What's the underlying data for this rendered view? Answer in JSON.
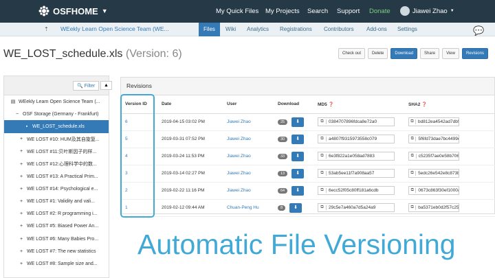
{
  "topnav": {
    "brand": "OSFHOME",
    "items": [
      "My Quick Files",
      "My Projects",
      "Search",
      "Support"
    ],
    "donate": "Donate",
    "user": "Jiawei Zhao"
  },
  "subnav": {
    "project": "WEekly Learn Open Science Team (WE...",
    "active": "Files",
    "items": [
      "Wiki",
      "Analytics",
      "Registrations",
      "Contributors",
      "Add-ons",
      "Settings"
    ]
  },
  "file": {
    "name": "WE_LOST_schedule.xls",
    "version": "(Version: 6)"
  },
  "buttons": [
    "Check out",
    "Delete",
    "Download",
    "Share",
    "View",
    "Revisions"
  ],
  "tree": {
    "filter": "Filter",
    "rows": [
      {
        "label": "WEekly Learn Open Science Team (...",
        "icon": "▤",
        "indent": 8
      },
      {
        "label": "OSF Storage (Germany - Frankfurt)",
        "icon": "−",
        "indent": 14
      },
      {
        "label": "WE_LOST_schedule.xls",
        "icon": "▪",
        "indent": 28,
        "selected": true
      },
      {
        "label": "WE LOST #10: HUM及其自旋复...",
        "icon": "+",
        "indent": 20
      },
      {
        "label": "WE LOST #11:贝叶斯因子的样...",
        "icon": "+",
        "indent": 20
      },
      {
        "label": "WE LOST #12:心理科学中的数...",
        "icon": "+",
        "indent": 20
      },
      {
        "label": "WE LOST #13: A Practical Prim...",
        "icon": "+",
        "indent": 20
      },
      {
        "label": "WE LOST #14: Psychological e...",
        "icon": "+",
        "indent": 20
      },
      {
        "label": "WE LOST #1: Validity and vali...",
        "icon": "+",
        "indent": 20
      },
      {
        "label": "WE LOST #2: R programming i...",
        "icon": "+",
        "indent": 20
      },
      {
        "label": "WE LOST #5: Biased Power An...",
        "icon": "+",
        "indent": 20
      },
      {
        "label": "WE LOST #6: Many Babies Pro...",
        "icon": "+",
        "indent": 20
      },
      {
        "label": "WE LOST #7: The new statistics",
        "icon": "+",
        "indent": 20
      },
      {
        "label": "WE LOST #8: Sample size and...",
        "icon": "+",
        "indent": 20
      }
    ]
  },
  "revisions": {
    "title": "Revisions",
    "headers": [
      "Version ID",
      "Date",
      "User",
      "Download",
      "MD5",
      "SHA2"
    ],
    "rows": [
      {
        "id": "6",
        "date": "2019-04-15 03:02 PM",
        "user": "Jiawei Zhao",
        "downloads": "25",
        "md5": "0384707896fdca8e72a0",
        "sha2": "bd812ea4542ad7db5058"
      },
      {
        "id": "5",
        "date": "2019-03-31 07:52 PM",
        "user": "Jiawei Zhao",
        "downloads": "30",
        "md5": "a4807f9315973558c079",
        "sha2": "5f6fd73dae7bc4499e81"
      },
      {
        "id": "4",
        "date": "2019-03-24 11:53 PM",
        "user": "Jiawei Zhao",
        "downloads": "33",
        "md5": "6e3f822a1e058ad7883",
        "sha2": "c5235f7ae0e58b7063b"
      },
      {
        "id": "3",
        "date": "2019-03-14 02:27 PM",
        "user": "Jiawei Zhao",
        "downloads": "13",
        "md5": "53ab5ee11f7a908aa57",
        "sha2": "5edc26e542e8c873b0d2"
      },
      {
        "id": "2",
        "date": "2019-02-22 11:16 PM",
        "user": "Jiawei Zhao",
        "downloads": "64",
        "md5": "6ecc52f05c80ff181a6cdb",
        "sha2": "0673c863f30ef1000abb"
      },
      {
        "id": "1",
        "date": "2019-02-12 09:44 AM",
        "user": "Chuan-Peng Hu",
        "downloads": "8",
        "md5": "29c5e7a460a7d5a24a9",
        "sha2": "ba5371eb0d2f57c259b0"
      }
    ]
  },
  "caption": "Automatic File Versioning",
  "colors": {
    "nav": "#263947",
    "accent": "#337ab7",
    "highlight": "#41a9d6",
    "donate": "#7ed07e"
  }
}
